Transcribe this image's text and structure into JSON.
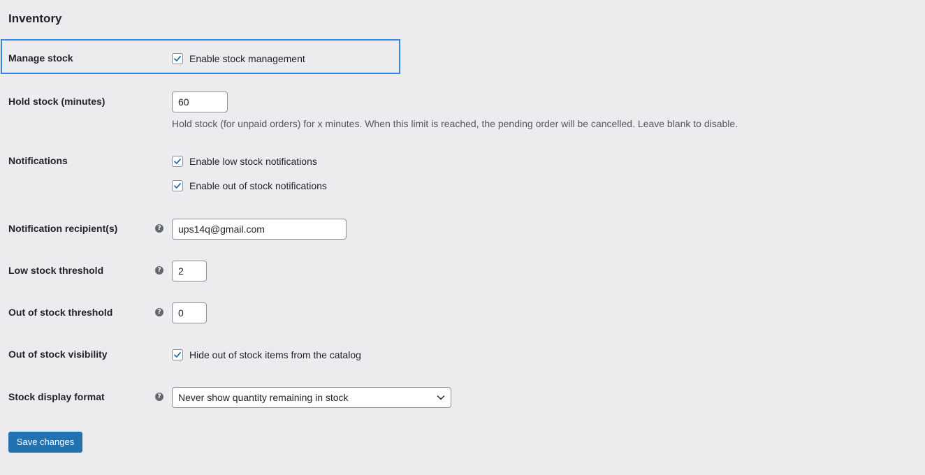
{
  "section": {
    "title": "Inventory"
  },
  "manage_stock": {
    "label": "Manage stock",
    "checkbox_label": "Enable stock management",
    "checked": true
  },
  "hold_stock": {
    "label": "Hold stock (minutes)",
    "value": "60",
    "description": "Hold stock (for unpaid orders) for x minutes. When this limit is reached, the pending order will be cancelled. Leave blank to disable."
  },
  "notifications": {
    "label": "Notifications",
    "low_stock_label": "Enable low stock notifications",
    "low_stock_checked": true,
    "out_of_stock_label": "Enable out of stock notifications",
    "out_of_stock_checked": true
  },
  "notification_recipient": {
    "label": "Notification recipient(s)",
    "value": "ups14q@gmail.com"
  },
  "low_stock_threshold": {
    "label": "Low stock threshold",
    "value": "2"
  },
  "out_of_stock_threshold": {
    "label": "Out of stock threshold",
    "value": "0"
  },
  "out_of_stock_visibility": {
    "label": "Out of stock visibility",
    "checkbox_label": "Hide out of stock items from the catalog",
    "checked": true
  },
  "stock_display_format": {
    "label": "Stock display format",
    "selected": "Never show quantity remaining in stock"
  },
  "help_icon_glyph": "?",
  "icons": {
    "help": "help-icon",
    "check": "checkmark-icon",
    "chevron": "chevron-down-icon"
  },
  "colors": {
    "accent": "#2271b1",
    "highlight": "#2f86e4",
    "background": "#ececef"
  },
  "save_button": {
    "label": "Save changes"
  }
}
